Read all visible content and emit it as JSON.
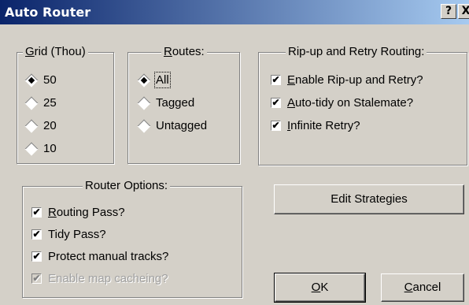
{
  "window": {
    "title": "Auto Router",
    "help_label": "?",
    "close_label": "X"
  },
  "grid": {
    "title_pre": "",
    "title_ul": "G",
    "title_post": "rid (Thou)",
    "options": [
      "50",
      "25",
      "20",
      "10"
    ]
  },
  "routes": {
    "title_pre": "",
    "title_ul": "R",
    "title_post": "outes:",
    "options": [
      "All",
      "Tagged",
      "Untagged"
    ]
  },
  "ripup": {
    "title": "Rip-up and Retry Routing:",
    "options": [
      {
        "ul": "E",
        "rest": "nable Rip-up and Retry?",
        "checked": true
      },
      {
        "ul": "A",
        "rest": "uto-tidy on Stalemate?",
        "checked": true
      },
      {
        "ul": "I",
        "rest": "nfinite Retry?",
        "checked": true
      }
    ]
  },
  "router_options": {
    "title": "Router Options:",
    "routing_pass": {
      "ul": "R",
      "rest": "outing Pass?",
      "checked": true
    },
    "tidy_pass": {
      "label": "Tidy Pass?",
      "checked": true
    },
    "protect": {
      "label": "Protect manual tracks?",
      "checked": true
    },
    "map_cache": {
      "label": "Enable map cacheing?",
      "checked": true,
      "disabled": true
    }
  },
  "buttons": {
    "edit_strategies": "Edit Strategies",
    "ok_ul": "O",
    "ok_rest": "K",
    "cancel_ul": "C",
    "cancel_rest": "ancel"
  }
}
